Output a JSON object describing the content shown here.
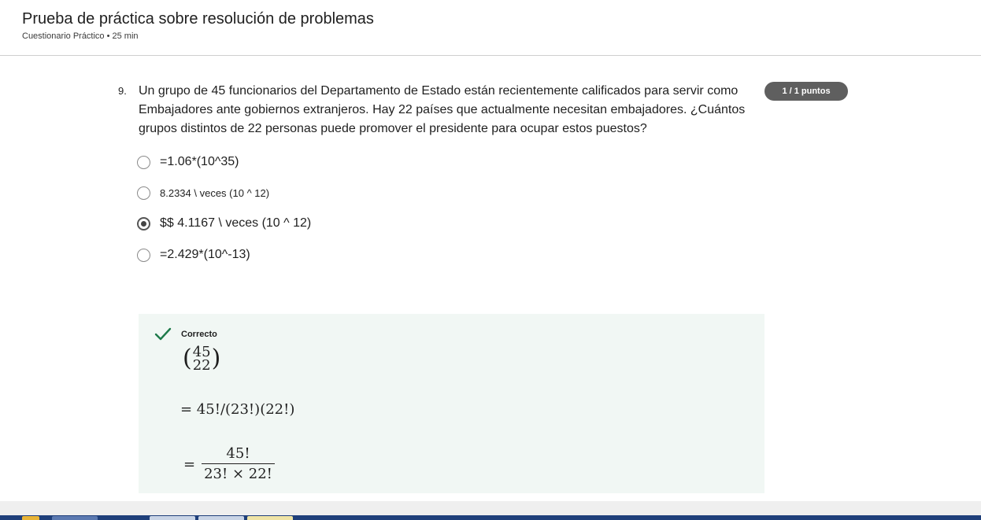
{
  "header": {
    "title": "Prueba de práctica sobre resolución de problemas",
    "subtitle": "Cuestionario Práctico • 25 min"
  },
  "question": {
    "number": "9.",
    "text": "Un grupo de 45 funcionarios del Departamento de Estado están recientemente calificados para servir como Embajadores ante gobiernos extranjeros. Hay 22 países que actualmente necesitan embajadores. ¿Cuántos grupos distintos de 22 personas puede promover el presidente para ocupar estos puestos?",
    "score_badge": "1 / 1 puntos",
    "options": [
      {
        "label": "=1.06*(10^35)",
        "selected": false
      },
      {
        "label": "8.2334 \\ veces (10 ^ 12)",
        "selected": false
      },
      {
        "label": "$$ 4.1167 \\ veces (10 ^ 12)",
        "selected": true
      },
      {
        "label": "=2.429*(10^-13)",
        "selected": false
      }
    ]
  },
  "feedback": {
    "status": "Correcto",
    "binom_top": "45",
    "binom_bottom": "22",
    "line1": "= 45!/(23!)(22!)",
    "eq_sign": "=",
    "frac_numerator": "45!",
    "frac_denominator": "23! × 22!"
  },
  "colors": {
    "badge_bg": "#5f5f5f",
    "feedback_bg": "#f1f7f4",
    "check_green": "#1e7a4a"
  }
}
